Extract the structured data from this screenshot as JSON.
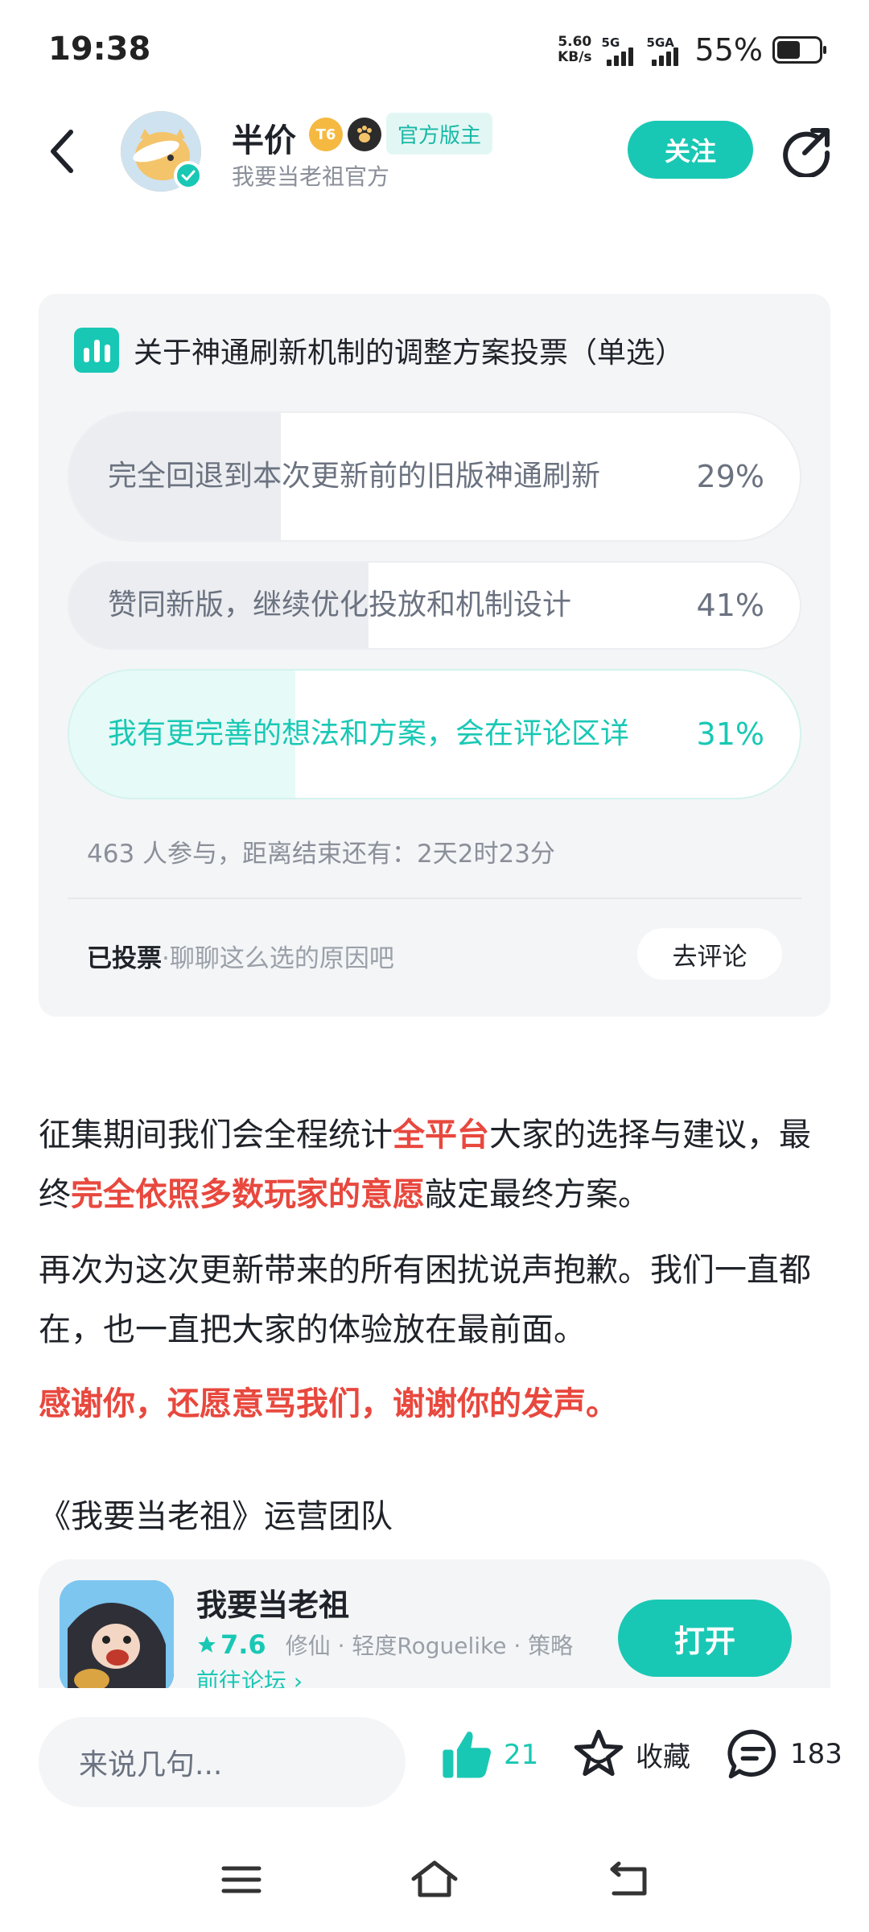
{
  "status_bar": {
    "time": "19:38",
    "net_speed_value": "5.60",
    "net_speed_unit": "KB/s",
    "sim1_label": "5G",
    "sim2_label": "5GA",
    "battery_percent": "55%",
    "battery_level": 0.55
  },
  "header": {
    "author_name": "半价",
    "level_badge": "T6",
    "moderator_badge": "官方版主",
    "author_subtitle": "我要当老祖官方",
    "follow_label": "关注"
  },
  "poll": {
    "title": "关于神通刷新机制的调整方案投票（单选）",
    "options": [
      {
        "label": "完全回退到本次更新前的旧版神通刷新",
        "percent": "29%",
        "fraction": 0.29,
        "selected": false
      },
      {
        "label": "赞同新版，继续优化投放和机制设计",
        "percent": "41%",
        "fraction": 0.41,
        "selected": false
      },
      {
        "label": "我有更完善的想法和方案，会在评论区详",
        "percent": "31%",
        "fraction": 0.31,
        "selected": true
      }
    ],
    "meta": "463 人参与，距离结束还有：2天2时23分",
    "voted_label": "已投票",
    "voted_hint": "·聊聊这么选的原因吧",
    "comment_button": "去评论"
  },
  "article": {
    "p1_a": "征集期间我们会全程统计",
    "p1_b": "全平台",
    "p1_c": "大家的选择与建议，最终",
    "p1_d": "完全依照多数玩家的意愿",
    "p1_e": "敲定最终方案。",
    "p2": "再次为这次更新带来的所有困扰说声抱歉。我们一直都在，也一直把大家的体验放在最前面。",
    "p3": "感谢你，还愿意骂我们，谢谢你的发声。",
    "p4": "《我要当老祖》运营团队"
  },
  "app_card": {
    "name": "我要当老祖",
    "rating": "7.6",
    "tags": "修仙 · 轻度Roguelike · 策略",
    "forum_link": "前往论坛",
    "open_label": "打开"
  },
  "bottom_bar": {
    "comment_placeholder": "来说几句...",
    "like_count": "21",
    "favorite_label": "收藏",
    "comment_count": "183"
  },
  "colors": {
    "accent": "#19c8b4",
    "highlight_red": "#e8483e",
    "card_bg": "#f4f5f7"
  },
  "icons": [
    "back-arrow-icon",
    "share-icon",
    "poll-chart-icon",
    "thumbs-up-icon",
    "star-icon",
    "comment-bubble-icon",
    "menu-icon",
    "home-icon",
    "back-nav-icon"
  ]
}
